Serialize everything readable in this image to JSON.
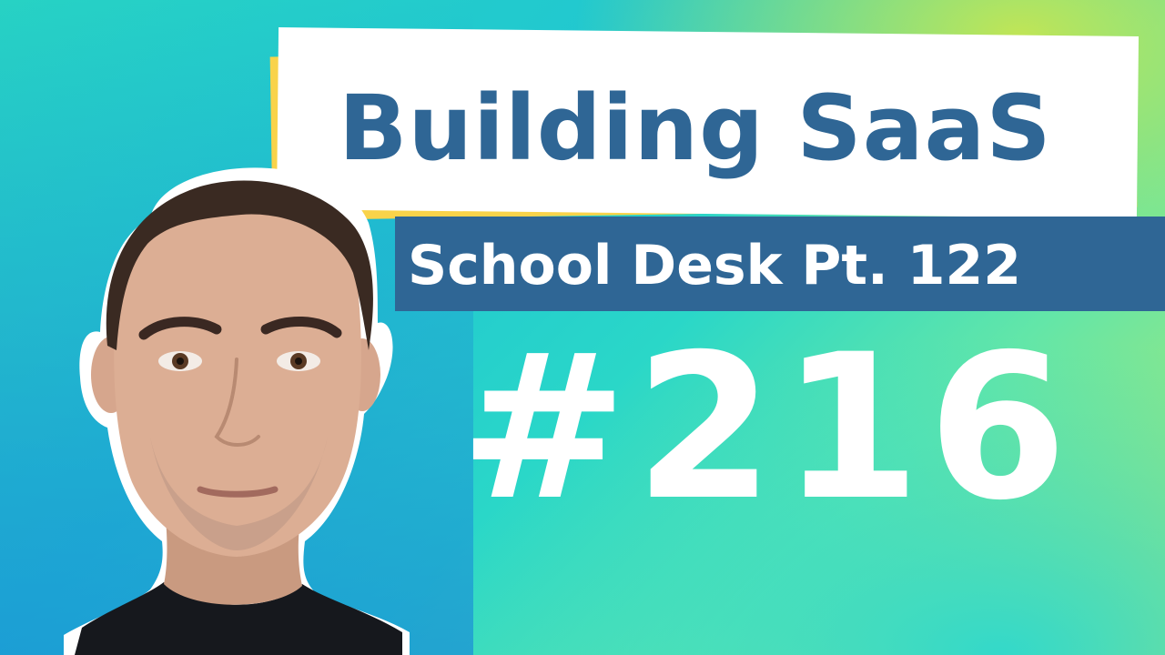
{
  "thumbnail": {
    "title": "Building SaaS",
    "subtitle": "School Desk Pt. 122",
    "episode": "#216"
  },
  "colors": {
    "brand_blue": "#2f6695",
    "accent_yellow": "#f9d34a",
    "background_teal": "#27d2c4",
    "background_lime": "#b7e86a",
    "text_white": "#ffffff"
  }
}
